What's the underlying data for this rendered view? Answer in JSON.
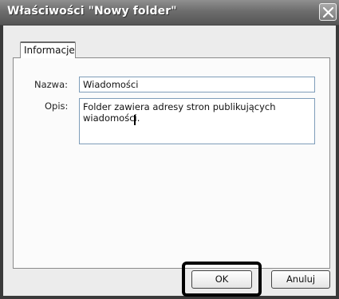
{
  "window": {
    "title": "Właściwości \"Nowy folder\"",
    "close_icon": "close-icon"
  },
  "tabs": [
    {
      "label": "Informacje",
      "active": true
    }
  ],
  "form": {
    "name_label": "Nazwa:",
    "name_value": "Wiadomości",
    "description_label": "Opis:",
    "description_value": "Folder zawiera adresy stron publikujących\nwiadomości."
  },
  "buttons": {
    "ok_label": "OK",
    "cancel_label": "Anuluj"
  }
}
